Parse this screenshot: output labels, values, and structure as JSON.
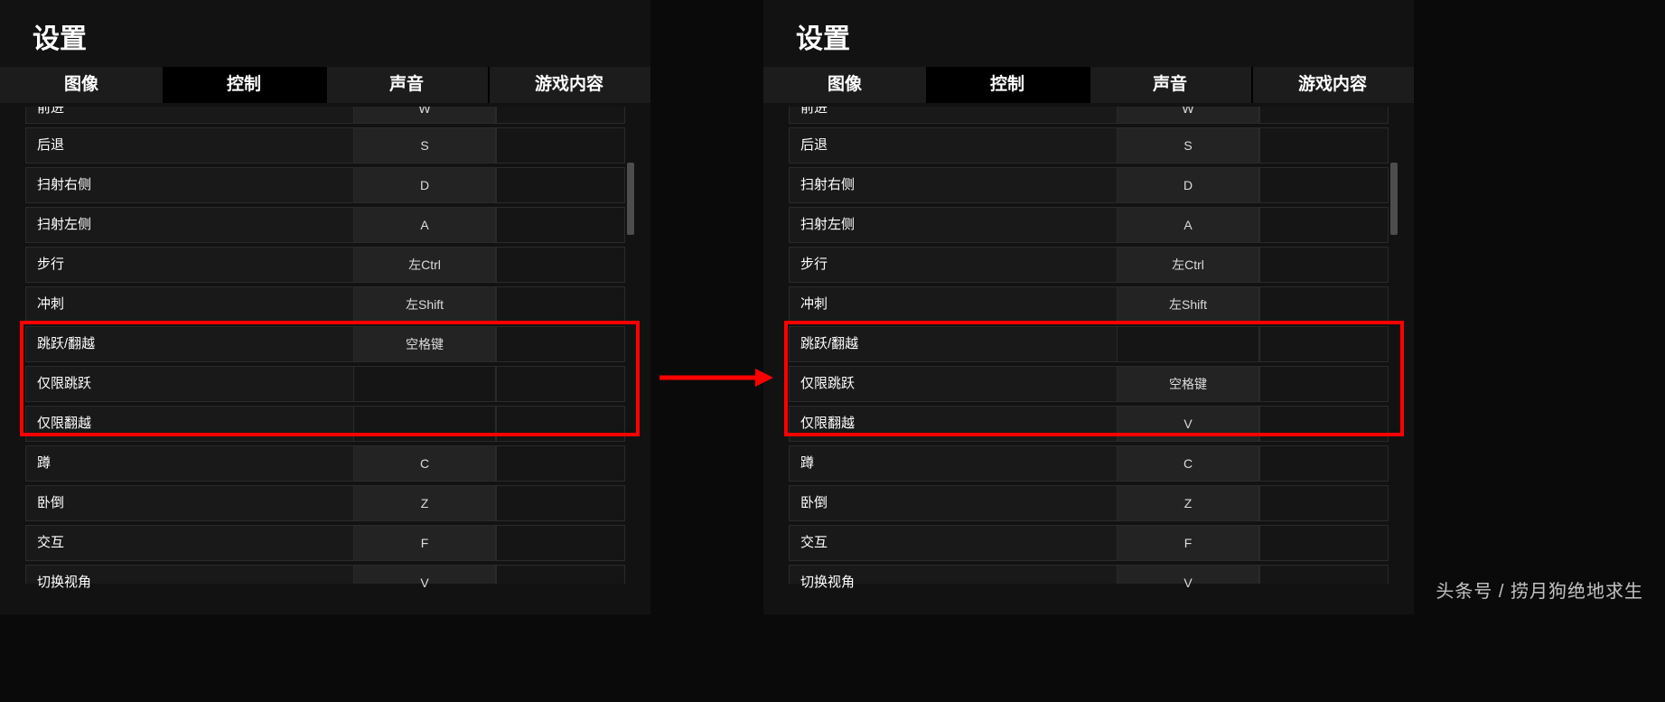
{
  "title": "设置",
  "tabs": [
    "图像",
    "控制",
    "声音",
    "游戏内容"
  ],
  "active_tab_index": 1,
  "watermark": "头条号 / 捞月狗绝地求生",
  "left": {
    "rows": [
      {
        "label": "前进",
        "key": "W",
        "partial": "top"
      },
      {
        "label": "后退",
        "key": "S"
      },
      {
        "label": "扫射右侧",
        "key": "D"
      },
      {
        "label": "扫射左侧",
        "key": "A"
      },
      {
        "label": "步行",
        "key": "左Ctrl"
      },
      {
        "label": "冲刺",
        "key": "左Shift"
      },
      {
        "label": "跳跃/翻越",
        "key": "空格键"
      },
      {
        "label": "仅限跳跃",
        "key": ""
      },
      {
        "label": "仅限翻越",
        "key": ""
      },
      {
        "label": "蹲",
        "key": "C"
      },
      {
        "label": "卧倒",
        "key": "Z"
      },
      {
        "label": "交互",
        "key": "F"
      },
      {
        "label": "切换视角",
        "key": "V",
        "partial": "bottom"
      }
    ]
  },
  "right": {
    "rows": [
      {
        "label": "前进",
        "key": "W",
        "partial": "top"
      },
      {
        "label": "后退",
        "key": "S"
      },
      {
        "label": "扫射右侧",
        "key": "D"
      },
      {
        "label": "扫射左侧",
        "key": "A"
      },
      {
        "label": "步行",
        "key": "左Ctrl"
      },
      {
        "label": "冲刺",
        "key": "左Shift"
      },
      {
        "label": "跳跃/翻越",
        "key": ""
      },
      {
        "label": "仅限跳跃",
        "key": "空格键"
      },
      {
        "label": "仅限翻越",
        "key": "V"
      },
      {
        "label": "蹲",
        "key": "C"
      },
      {
        "label": "卧倒",
        "key": "Z"
      },
      {
        "label": "交互",
        "key": "F"
      },
      {
        "label": "切换视角",
        "key": "V",
        "partial": "bottom"
      }
    ]
  }
}
